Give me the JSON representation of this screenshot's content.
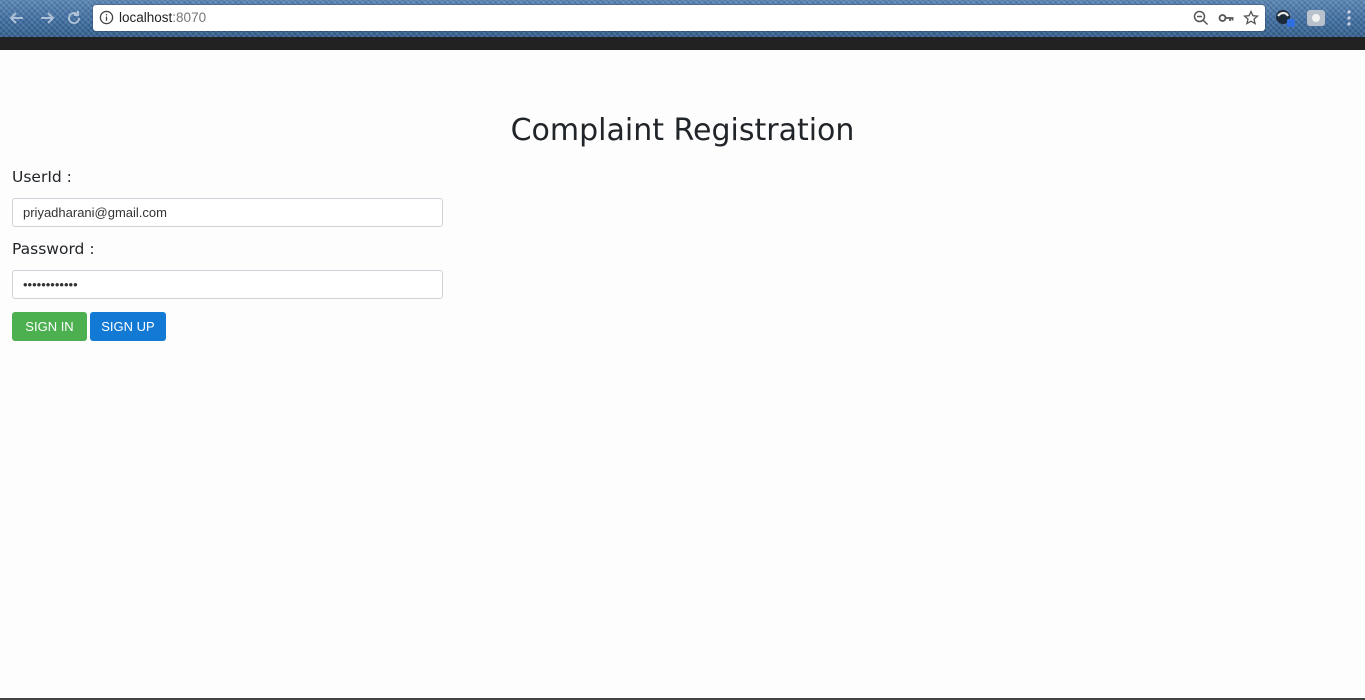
{
  "browser": {
    "url_host": "localhost",
    "url_port": ":8070"
  },
  "page": {
    "title": "Complaint Registration",
    "userid_label": "UserId :",
    "userid_value": "priyadharani@gmail.com",
    "password_label": "Password :",
    "password_value": "••••••••••••",
    "signin_label": "SIGN IN",
    "signup_label": "SIGN UP"
  },
  "colors": {
    "signin": "#4cb050",
    "signup": "#1279d4",
    "title_text": "#212529"
  }
}
